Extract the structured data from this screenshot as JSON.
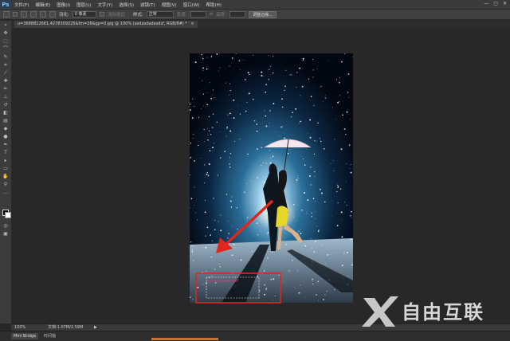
{
  "app": {
    "logo": "Ps"
  },
  "menu": [
    "文件(F)",
    "编辑(E)",
    "图像(I)",
    "图层(L)",
    "文字(Y)",
    "选择(S)",
    "滤镜(T)",
    "视图(V)",
    "窗口(W)",
    "帮助(H)"
  ],
  "window_controls": [
    "—",
    "▢",
    "✕"
  ],
  "options": {
    "feather_label": "羽化:",
    "feather_value": "0 像素",
    "antialias_label": "消除锯齿",
    "style_label": "样式:",
    "style_value": "正常",
    "width_label": "宽度:",
    "height_label": "高度:",
    "refine_button": "调整边缘..."
  },
  "document": {
    "tab_title": "u=3688812661,4278309225&fm=26&gp=0.jpg @ 100% (asdasdadasdsf, RGB/8#) *",
    "close_glyph": "×",
    "selection_text": "asdasdadasdsf"
  },
  "status": {
    "zoom": "100%",
    "doc_size": "文档:1.07M/2.59M",
    "arrow": "▶"
  },
  "bottom_tabs": [
    "Mini Bridge",
    "时间轴"
  ],
  "watermark": {
    "text": "自由互联"
  },
  "colors": {
    "annotation": "#e0261e",
    "accent": "#c8742b"
  }
}
